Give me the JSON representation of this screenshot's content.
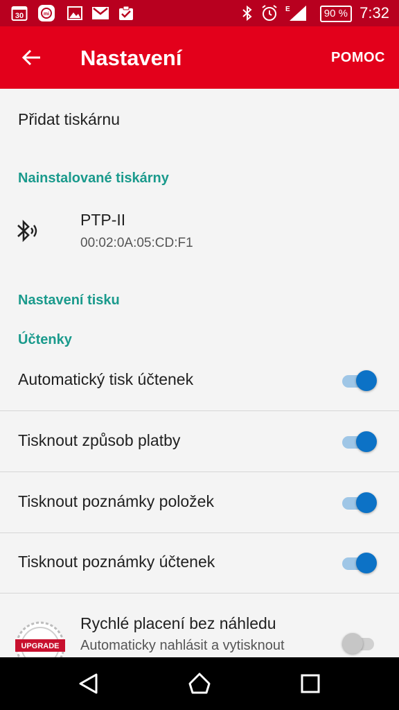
{
  "status_bar": {
    "time": "7:32",
    "battery": "90 %",
    "calendar_day": "30",
    "icons": [
      "calendar-icon",
      "mi-icon",
      "image-icon",
      "gmail-icon",
      "task-done-icon",
      "bluetooth-icon",
      "alarm-icon",
      "signal-icon"
    ]
  },
  "app_bar": {
    "title": "Nastavení",
    "help_label": "POMOC",
    "back_icon": "arrow-back-icon"
  },
  "add_printer_label": "Přidat tiskárnu",
  "installed_printers": {
    "header": "Nainstalované tiskárny",
    "items": [
      {
        "name": "PTP-II",
        "address": "00:02:0A:05:CD:F1",
        "icon": "bluetooth-searching-icon"
      }
    ]
  },
  "print_settings": {
    "header": "Nastavení tisku",
    "subheader": "Účtenky",
    "toggles": [
      {
        "label": "Automatický tisk účtenek",
        "on": true
      },
      {
        "label": "Tisknout způsob platby",
        "on": true
      },
      {
        "label": "Tisknout poznámky položek",
        "on": true
      },
      {
        "label": "Tisknout poznámky účtenek",
        "on": true
      }
    ],
    "fast_pay": {
      "title": "Rychlé placení bez náhledu",
      "subtitle": "Automaticky nahlásit a vytisknout",
      "badge": "UPGRADE",
      "on": false
    }
  },
  "colors": {
    "app_bar": "#e3001b",
    "status_bar": "#b8001f",
    "section_accent": "#1a9a8c",
    "switch_on": "#0c72c6"
  },
  "nav_bar": {
    "icons": [
      "back-triangle-icon",
      "home-icon",
      "recents-icon"
    ]
  }
}
